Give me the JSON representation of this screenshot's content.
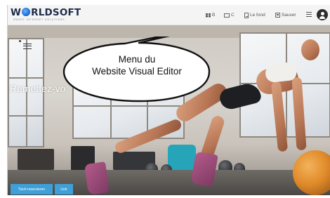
{
  "logo": {
    "text_left": "W",
    "text_right": "RLDSOFT",
    "tagline": "SMART INTERNET SOLUTIONS"
  },
  "toolbar": {
    "blocks_label": "B",
    "content_label": "C",
    "background_label": "Le fond",
    "save_label": "Sauver"
  },
  "hero": {
    "heading": "Remettez-vo",
    "primary_button": "Tisch reservieren",
    "link_button": "Link"
  },
  "callout": {
    "line1": "Menu du",
    "line2": "Website Visual Editor"
  },
  "colors": {
    "button_blue": "#3fa0d8",
    "logo_navy": "#1f2b4a",
    "ball_orange": "#e08a2a"
  }
}
